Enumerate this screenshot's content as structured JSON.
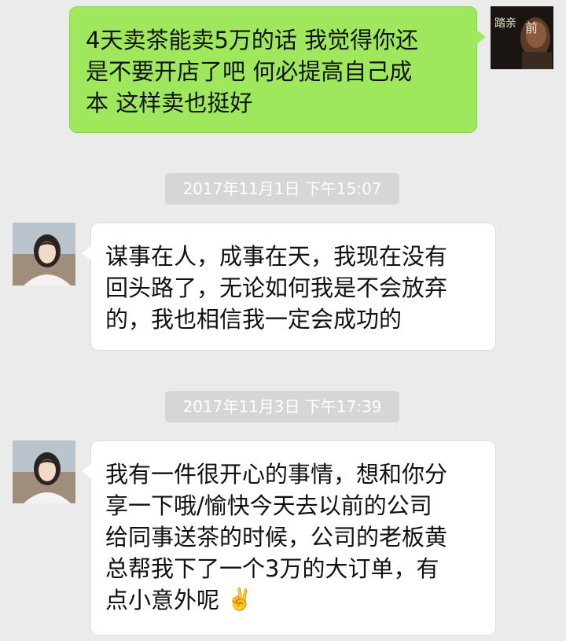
{
  "messages": [
    {
      "side": "sent",
      "lines": [
        "4天卖茶能卖5万的话 我觉得你还",
        "是不要开店了吧 何必提高自己成",
        "本 这样卖也挺好"
      ]
    },
    {
      "timestamp": "2017年11月1日 下午15:07"
    },
    {
      "side": "received",
      "lines": [
        "谋事在人，成事在天，我现在没有",
        "回头路了，无论如何我是不会放弃",
        "的，我也相信我一定会成功的"
      ]
    },
    {
      "timestamp": "2017年11月3日 下午17:39"
    },
    {
      "side": "received",
      "lines": [
        "我有一件很开心的事情，想和你分",
        "享一下哦/愉快今天去以前的公司",
        "给同事送茶的时候，公司的老板黄",
        "总帮我下了一个3万的大订单，有",
        "点小意外呢"
      ],
      "emoji": "✌️",
      "emoji_name": "victory-hand-emoji"
    }
  ],
  "avatars": {
    "self": "self-avatar",
    "contact": "contact-avatar"
  },
  "colors": {
    "background": "#ebebeb",
    "sent_bubble": "#9fe85d",
    "received_bubble": "#ffffff",
    "timestamp_bg": "#d6d6d6"
  }
}
